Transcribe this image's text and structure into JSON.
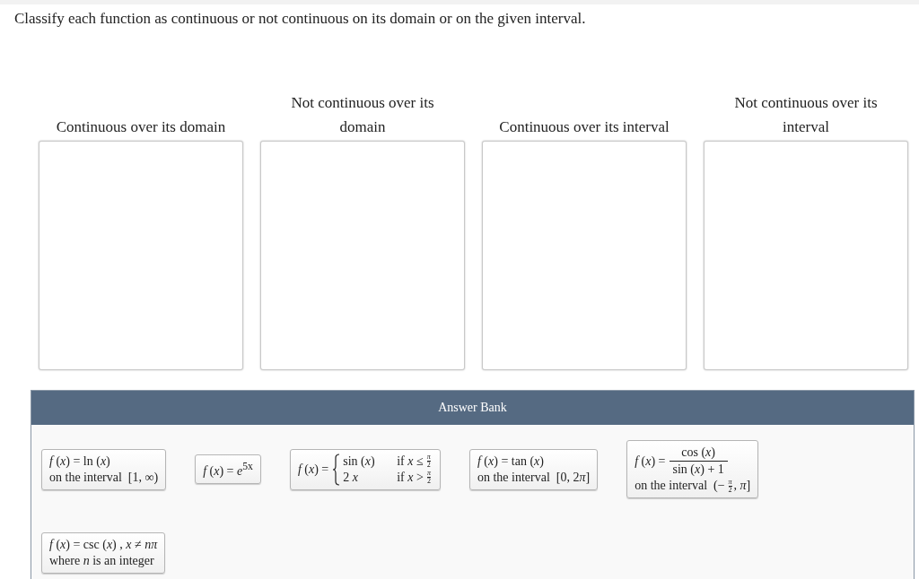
{
  "instruction": "Classify each function as continuous or not continuous on its domain or on the given interval.",
  "categories": [
    {
      "label": "Continuous over its domain"
    },
    {
      "label": "Not continuous over its domain"
    },
    {
      "label": "Continuous over its interval"
    },
    {
      "label": "Not continuous over its interval"
    }
  ],
  "answer_bank": {
    "title": "Answer Bank",
    "cards": [
      {
        "kind": "lines",
        "lines": [
          [
            {
              "kind": "text",
              "text": "*f* (*x*) = ln (*x*)"
            }
          ],
          [
            {
              "kind": "text",
              "text": "on the interval  [1, ∞)"
            }
          ]
        ]
      },
      {
        "kind": "lines",
        "lines": [
          [
            {
              "kind": "text",
              "text": "*f* (*x*) = *e*$^{5x}$"
            }
          ]
        ]
      },
      {
        "kind": "piecewise",
        "lhs": "*f* (*x*) =",
        "cases": [
          {
            "expr": "sin (*x*)",
            "cond": [
              {
                "kind": "text",
                "text": "if *x* ≤"
              },
              {
                "kind": "frac",
                "num": "*π*",
                "den": "2"
              }
            ]
          },
          {
            "expr": "2 *x*",
            "cond": [
              {
                "kind": "text",
                "text": "if *x* >"
              },
              {
                "kind": "frac",
                "num": "*π*",
                "den": "2"
              }
            ]
          }
        ]
      },
      {
        "kind": "lines",
        "lines": [
          [
            {
              "kind": "text",
              "text": "*f* (*x*) = tan (*x*)"
            }
          ],
          [
            {
              "kind": "text",
              "text": "on the interval  [0, 2"
            },
            {
              "kind": "text",
              "text": "*π*]"
            }
          ]
        ]
      },
      {
        "kind": "fraction",
        "lhs": "*f* (*x*) =",
        "num": "cos (*x*)",
        "den": "sin (*x*) + 1",
        "lines": [
          [
            {
              "kind": "text",
              "text": "on the interval  (−"
            },
            {
              "kind": "frac",
              "num": "*π*",
              "den": "2"
            },
            {
              "kind": "text",
              "text": ", *π*]"
            }
          ]
        ]
      },
      {
        "kind": "lines",
        "lines": [
          [
            {
              "kind": "text",
              "text": "*f* (*x*) = csc (*x*) , *x* ≠ *nπ*"
            }
          ],
          [
            {
              "kind": "text",
              "text": "where *n* is an integer"
            }
          ]
        ]
      }
    ]
  }
}
